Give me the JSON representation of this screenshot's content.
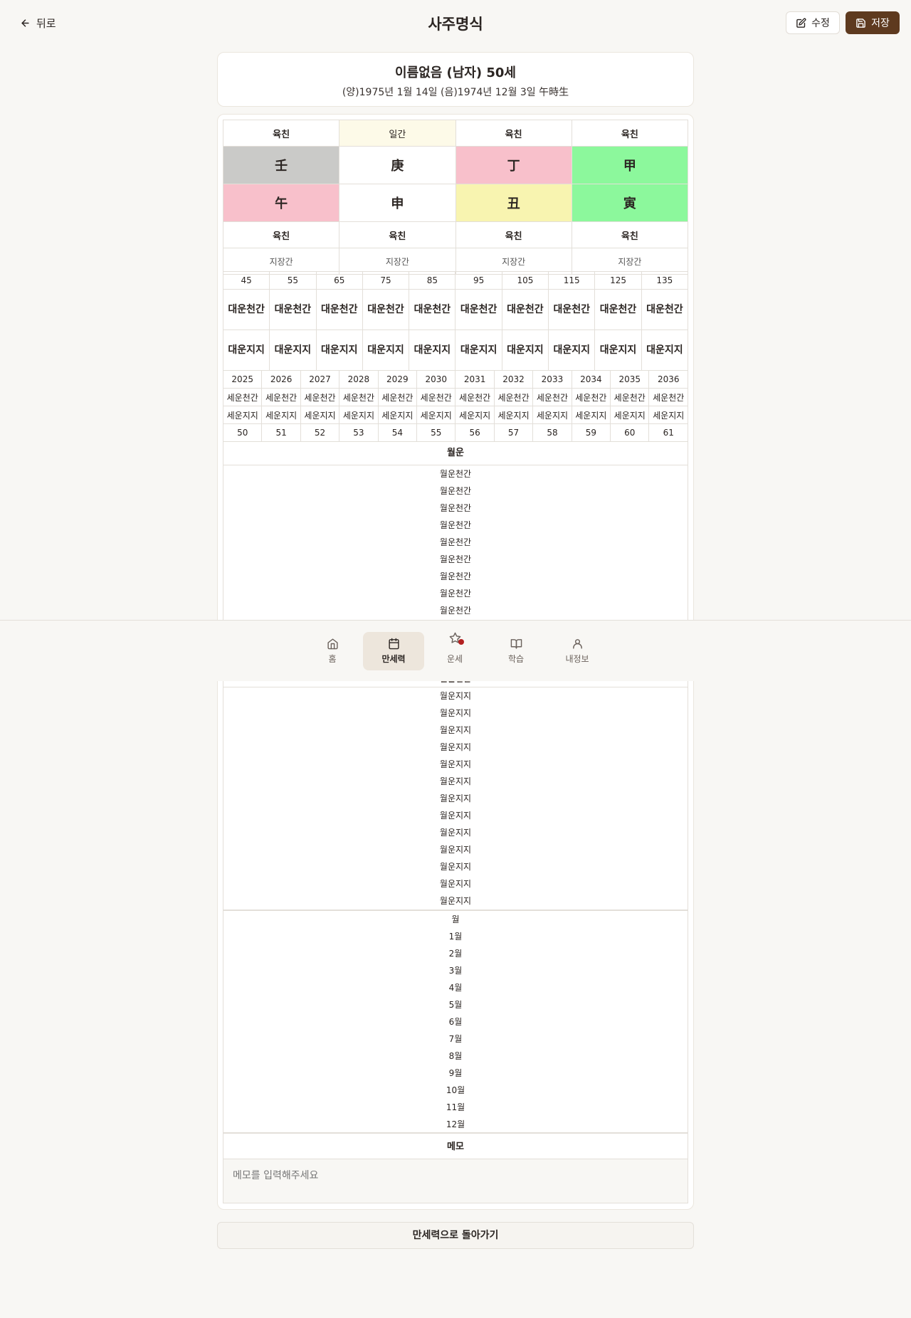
{
  "header": {
    "back_label": "뒤로",
    "title": "사주명식",
    "edit_label": "수정",
    "save_label": "저장"
  },
  "profile": {
    "name_line": "이름없음 (남자) 50세",
    "birth_line": "(양)1975년 1월 14일 (음)1974년 12월 3일 午時生"
  },
  "pillars": {
    "top_labels": [
      "육친",
      "일간",
      "육친",
      "육친"
    ],
    "stems": [
      "壬",
      "庚",
      "丁",
      "甲"
    ],
    "branches": [
      "午",
      "申",
      "丑",
      "寅"
    ],
    "bottom_labels": [
      "육친",
      "육친",
      "육친",
      "육친"
    ],
    "hidden_labels": [
      "지장간",
      "지장간",
      "지장간",
      "지장간"
    ],
    "colors": {
      "gray": "#cacac8",
      "pink": "#f8c0cb",
      "yellow": "#f8f4b0",
      "green": "#8cf89c",
      "white": "#ffffff",
      "day_header": "#fdfae8"
    }
  },
  "daeun": {
    "ages": [
      "45",
      "55",
      "65",
      "75",
      "85",
      "95",
      "105",
      "115",
      "125",
      "135"
    ],
    "stem_label": "대운천간",
    "branch_label": "대운지지"
  },
  "seun": {
    "years": [
      "2025",
      "2026",
      "2027",
      "2028",
      "2029",
      "2030",
      "2031",
      "2032",
      "2033",
      "2034",
      "2035",
      "2036"
    ],
    "stem_label": "세운천간",
    "branch_label": "세운지지",
    "ages": [
      "50",
      "51",
      "52",
      "53",
      "54",
      "55",
      "56",
      "57",
      "58",
      "59",
      "60",
      "61"
    ]
  },
  "wolun": {
    "title": "월운",
    "stem_label": "월운천간",
    "branch_label": "월운지지",
    "month_header": "월",
    "months": [
      "1월",
      "2월",
      "3월",
      "4월",
      "5월",
      "6월",
      "7월",
      "8월",
      "9월",
      "10월",
      "11월",
      "12월"
    ]
  },
  "memo": {
    "title": "메모",
    "placeholder": "메모를 입력해주세요"
  },
  "return_label": "만세력으로 돌아가기",
  "nav": [
    {
      "label": "홈",
      "icon": "home-icon"
    },
    {
      "label": "만세력",
      "icon": "calendar-icon"
    },
    {
      "label": "운세",
      "icon": "star-icon"
    },
    {
      "label": "학습",
      "icon": "book-icon"
    },
    {
      "label": "내정보",
      "icon": "user-icon"
    }
  ]
}
